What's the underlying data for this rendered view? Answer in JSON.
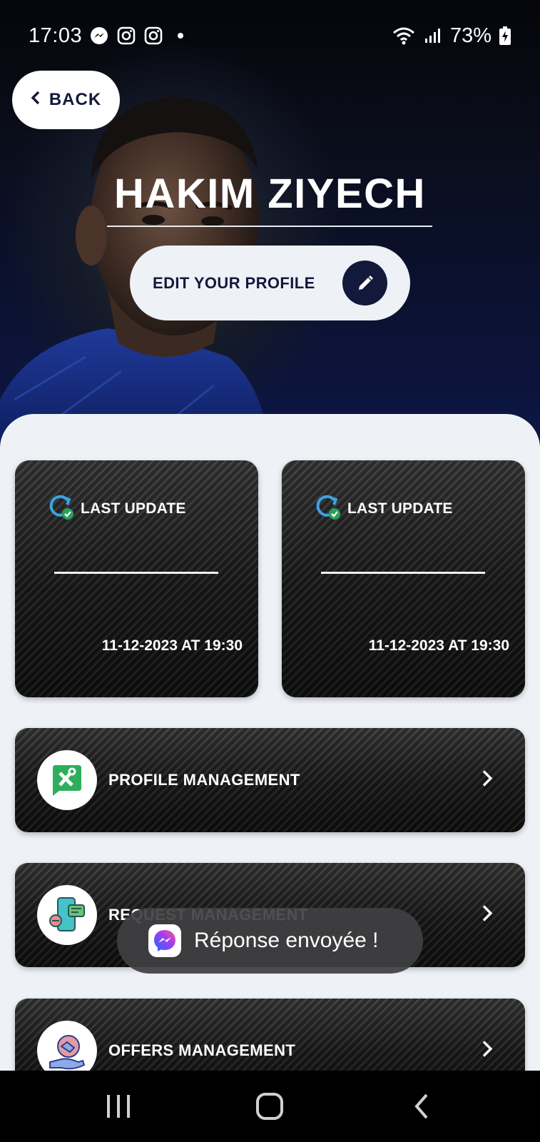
{
  "status_bar": {
    "time": "17:03",
    "battery": "73%",
    "icons": [
      "messenger-icon",
      "instagram-icon",
      "instagram-icon",
      "dot-icon",
      "wifi-icon",
      "signal-icon",
      "battery-icon"
    ]
  },
  "header": {
    "back_label": "BACK",
    "player_name": "HAKIM ZIYECH",
    "edit_label": "EDIT YOUR PROFILE",
    "edit_icon": "pencil-icon"
  },
  "update_cards": [
    {
      "label": "LAST UPDATE",
      "date": "11-12-2023 AT 19:30",
      "icon": "refresh-check-icon"
    },
    {
      "label": "LAST UPDATE",
      "date": "11-12-2023 AT 19:30",
      "icon": "refresh-check-icon"
    }
  ],
  "menu": [
    {
      "label": "PROFILE MANAGEMENT",
      "icon": "tools-chat-icon"
    },
    {
      "label": "REQUEST MANAGEMENT",
      "icon": "phone-request-icon"
    },
    {
      "label": "OFFERS MANAGEMENT",
      "icon": "handshake-offer-icon"
    }
  ],
  "toast": {
    "text": "Réponse envoyée !",
    "icon": "messenger-icon"
  },
  "nav_bar": {
    "icons": [
      "recent-apps-icon",
      "home-icon",
      "back-nav-icon"
    ]
  },
  "colors": {
    "navy": "#13193a",
    "sheet": "#eef2f7",
    "accent_blue": "#3aa3e6",
    "check_green": "#27a05a"
  }
}
